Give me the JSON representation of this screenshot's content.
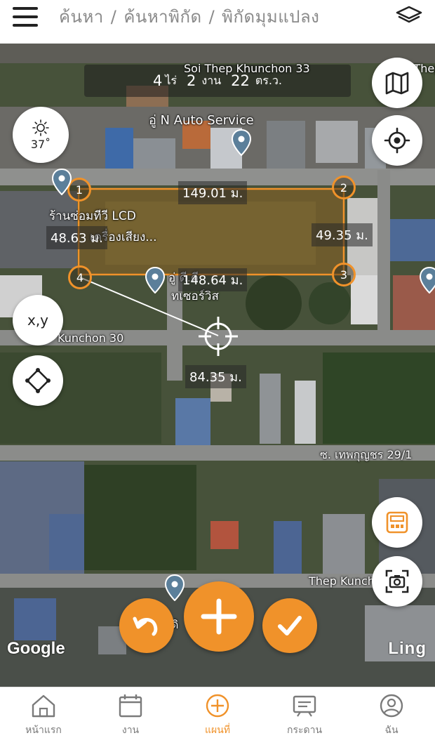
{
  "header": {
    "breadcrumb": [
      "ค้นหา",
      "ค้นหาพิกัด",
      "พิกัดมุมแปลง"
    ],
    "separator": "/"
  },
  "map": {
    "area": {
      "rai": "4",
      "rai_unit": "ไร่",
      "ngan": "2",
      "ngan_unit": "งาน",
      "wa": "22",
      "wa_unit": "ตร.ว."
    },
    "labels": {
      "road_top": "Soi Thep Khunchon 33",
      "road_top_right": "Soi Thep K",
      "poi_auto": "อู่ N Auto Service",
      "poi_tv": "ร้านซ่อมทีวี LCD",
      "poi_tv_2": "เครื่องเสียง...",
      "poi_pin3": "อู่ ดี.ดี.",
      "poi_pin3_2": "ทเซอร์วิส",
      "road_mid": "Kunchon 30",
      "road_lower": "ซ. เทพกุญชร 29/1",
      "road_bottom": "Thep Kunch",
      "poi_bottom": "ดิ"
    },
    "edges": {
      "top": "149.01 ม.",
      "right": "49.35 ม.",
      "bottom": "148.64 ม.",
      "left": "48.63 ม.",
      "to_cursor": "84.35 ม."
    },
    "vertices": [
      "1",
      "2",
      "3",
      "4"
    ],
    "weather": {
      "icon": "sun-icon",
      "temp": "37˚"
    },
    "xy_label": "x,y",
    "google": "Google",
    "brand": "Ling"
  },
  "colors": {
    "accent": "#f0922a",
    "pin": "#5b7f9a"
  },
  "nav": [
    {
      "label": "หน้าแรก",
      "icon": "home-icon"
    },
    {
      "label": "งาน",
      "icon": "calendar-icon"
    },
    {
      "label": "แผนที่",
      "icon": "map-plus-icon",
      "active": true
    },
    {
      "label": "กระดาน",
      "icon": "board-icon"
    },
    {
      "label": "ฉัน",
      "icon": "user-icon"
    }
  ]
}
